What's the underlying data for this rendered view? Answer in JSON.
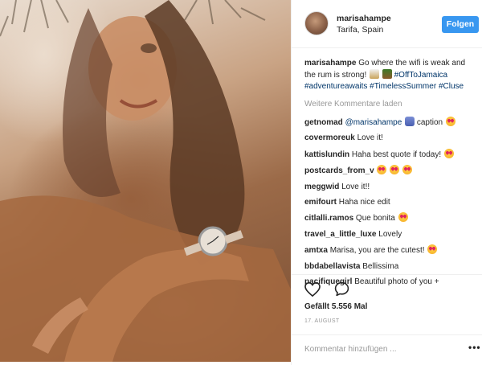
{
  "post": {
    "author": {
      "username": "marisahampe",
      "location": "Tarifa, Spain"
    },
    "follow_label": "Folgen",
    "caption": {
      "username": "marisahampe",
      "text": "Go where the wifi is weak and the rum is strong!",
      "hashtags": [
        "#OffToJamaica",
        "#adventureawaits",
        "#TimelessSummer",
        "#Cluse"
      ]
    },
    "load_more_label": "Weitere Kommentare laden",
    "comments": [
      {
        "username": "getnomad",
        "mention": "@marisahampe",
        "text": "caption",
        "emoji": "hand+heart"
      },
      {
        "username": "covermoreuk",
        "text": "Love it!"
      },
      {
        "username": "kattislundin",
        "text": "Haha best quote if today!",
        "emoji": "heart"
      },
      {
        "username": "postcards_from_v",
        "text": "",
        "emoji": "heart x3"
      },
      {
        "username": "meggwid",
        "text": "Love it!!"
      },
      {
        "username": "emifourt",
        "text": "Haha nice edit"
      },
      {
        "username": "citlalli.ramos",
        "text": "Que bonita",
        "emoji": "heart"
      },
      {
        "username": "travel_a_little_luxe",
        "text": "Lovely"
      },
      {
        "username": "amtxa",
        "text": "Marisa, you are the cutest!",
        "emoji": "kiss"
      },
      {
        "username": "bbdabellavista",
        "text": "Bellissima"
      },
      {
        "username": "pacifiquegirl",
        "text": "Beautiful photo of you +"
      }
    ],
    "likes_label": "Gefällt 5.556 Mal",
    "date_label": "17. AUGUST",
    "comment_placeholder": "Kommentar hinzufügen ...",
    "more_options_label": "•••"
  },
  "icons": {
    "like": "heart-outline-icon",
    "comment": "speech-bubble-icon"
  },
  "colors": {
    "follow_button": "#3897f0",
    "hashtag": "#003569",
    "muted": "#999999",
    "text": "#262626"
  }
}
